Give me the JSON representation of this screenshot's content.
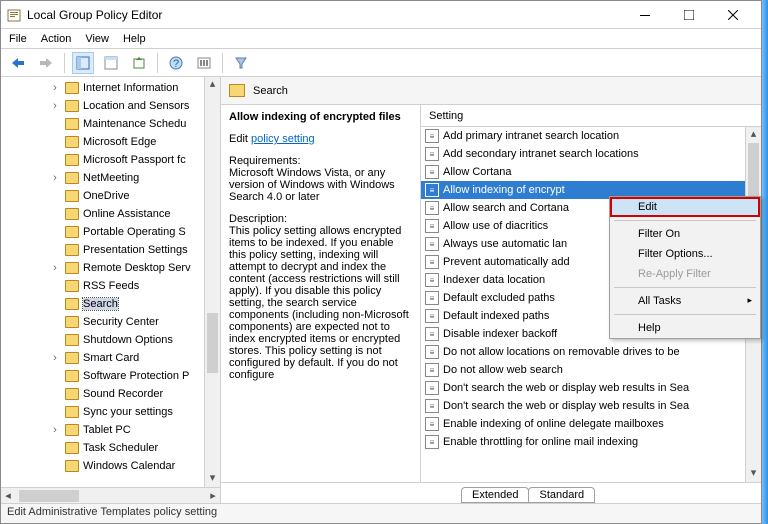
{
  "window": {
    "title": "Local Group Policy Editor"
  },
  "menubar": [
    "File",
    "Action",
    "View",
    "Help"
  ],
  "tree": {
    "items": [
      {
        "label": "Internet Information",
        "depth": 4,
        "exp": ">"
      },
      {
        "label": "Location and Sensors",
        "depth": 4,
        "exp": ">"
      },
      {
        "label": "Maintenance Schedu",
        "depth": 4,
        "exp": ""
      },
      {
        "label": "Microsoft Edge",
        "depth": 4,
        "exp": ""
      },
      {
        "label": "Microsoft Passport fc",
        "depth": 4,
        "exp": ""
      },
      {
        "label": "NetMeeting",
        "depth": 4,
        "exp": ">"
      },
      {
        "label": "OneDrive",
        "depth": 4,
        "exp": ""
      },
      {
        "label": "Online Assistance",
        "depth": 4,
        "exp": ""
      },
      {
        "label": "Portable Operating S",
        "depth": 4,
        "exp": ""
      },
      {
        "label": "Presentation Settings",
        "depth": 4,
        "exp": ""
      },
      {
        "label": "Remote Desktop Serv",
        "depth": 4,
        "exp": ">"
      },
      {
        "label": "RSS Feeds",
        "depth": 4,
        "exp": ""
      },
      {
        "label": "Search",
        "depth": 4,
        "exp": "",
        "sel": true
      },
      {
        "label": "Security Center",
        "depth": 4,
        "exp": ""
      },
      {
        "label": "Shutdown Options",
        "depth": 4,
        "exp": ""
      },
      {
        "label": "Smart Card",
        "depth": 4,
        "exp": ">"
      },
      {
        "label": "Software Protection P",
        "depth": 4,
        "exp": ""
      },
      {
        "label": "Sound Recorder",
        "depth": 4,
        "exp": ""
      },
      {
        "label": "Sync your settings",
        "depth": 4,
        "exp": ""
      },
      {
        "label": "Tablet PC",
        "depth": 4,
        "exp": ">"
      },
      {
        "label": "Task Scheduler",
        "depth": 4,
        "exp": ""
      },
      {
        "label": "Windows Calendar",
        "depth": 4,
        "exp": ""
      }
    ]
  },
  "pane": {
    "path": "Search",
    "title": "Allow indexing of encrypted files",
    "edit_prefix": "Edit",
    "edit_link": "policy setting",
    "req_label": "Requirements:",
    "req_text": "Microsoft Windows Vista, or any version of Windows with Windows Search 4.0 or later",
    "desc_label": "Description:",
    "desc_text": "This policy setting allows encrypted items to be indexed. If you enable this policy setting, indexing will attempt to decrypt and index the content (access restrictions will still apply). If you disable this policy setting, the search service components (including non-Microsoft components) are expected not to index encrypted items or encrypted stores. This policy setting is not configured by default. If you do not configure"
  },
  "list": {
    "header": "Setting",
    "items": [
      "Add primary intranet search location",
      "Add secondary intranet search locations",
      "Allow Cortana",
      "Allow indexing of encrypt",
      "Allow search and Cortana",
      "Allow use of diacritics",
      "Always use automatic lan",
      "Prevent automatically add",
      "Indexer data location",
      "Default excluded paths",
      "Default indexed paths",
      "Disable indexer backoff",
      "Do not allow locations on removable drives to be",
      "Do not allow web search",
      "Don't search the web or display web results in Sea",
      "Don't search the web or display web results in Sea",
      "Enable indexing of online delegate mailboxes",
      "Enable throttling for online mail indexing"
    ],
    "selected_index": 3
  },
  "context_menu": {
    "items": [
      {
        "label": "Edit",
        "hl": true
      },
      {
        "sep": true
      },
      {
        "label": "Filter On"
      },
      {
        "label": "Filter Options..."
      },
      {
        "label": "Re-Apply Filter",
        "disabled": true
      },
      {
        "sep": true
      },
      {
        "label": "All Tasks",
        "submenu": true
      },
      {
        "sep": true
      },
      {
        "label": "Help"
      }
    ]
  },
  "tabs": {
    "extended": "Extended",
    "standard": "Standard"
  },
  "statusbar": "Edit Administrative Templates policy setting"
}
